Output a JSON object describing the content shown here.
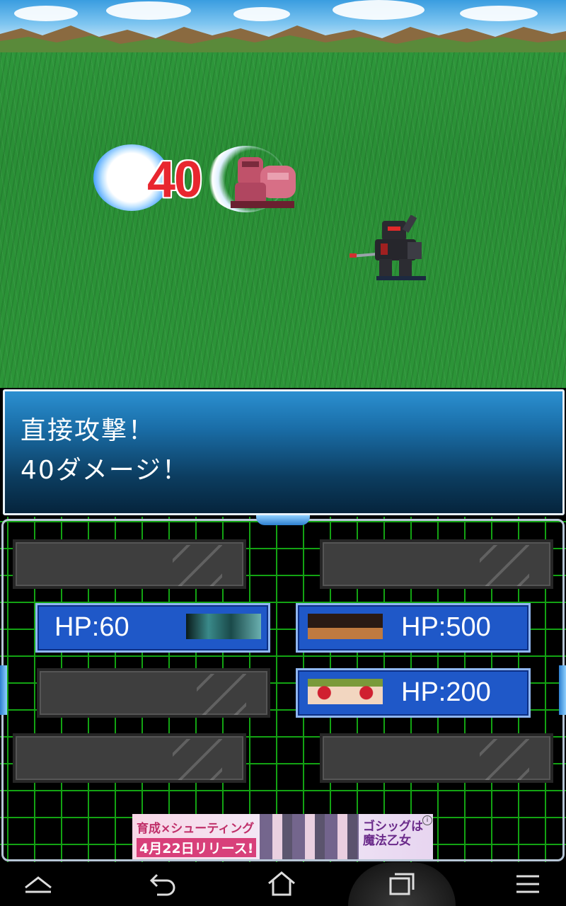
{
  "battle": {
    "damage_popup": "40"
  },
  "message": {
    "line1": "直接攻撃！",
    "line2": "40ダメージ！"
  },
  "units": {
    "left_unit_hp": "HP:60",
    "right_unit_top_hp": "HP:500",
    "right_unit_bottom_hp": "HP:200"
  },
  "ad": {
    "line1": "育成×シューティング",
    "line2": "4月22日リリース!",
    "logo_text": "ゴシッグは魔法乙女",
    "info_badge": "i"
  },
  "navbar": {
    "icons": [
      "up-chevron-icon",
      "back-icon",
      "home-icon",
      "recents-icon",
      "menu-icon"
    ]
  },
  "colors": {
    "grass": "#2c9538",
    "message_box": "#1a6ea8",
    "grid_line": "#13a313",
    "unit_panel": "#1f58c8",
    "damage_text": "#e8262f"
  }
}
